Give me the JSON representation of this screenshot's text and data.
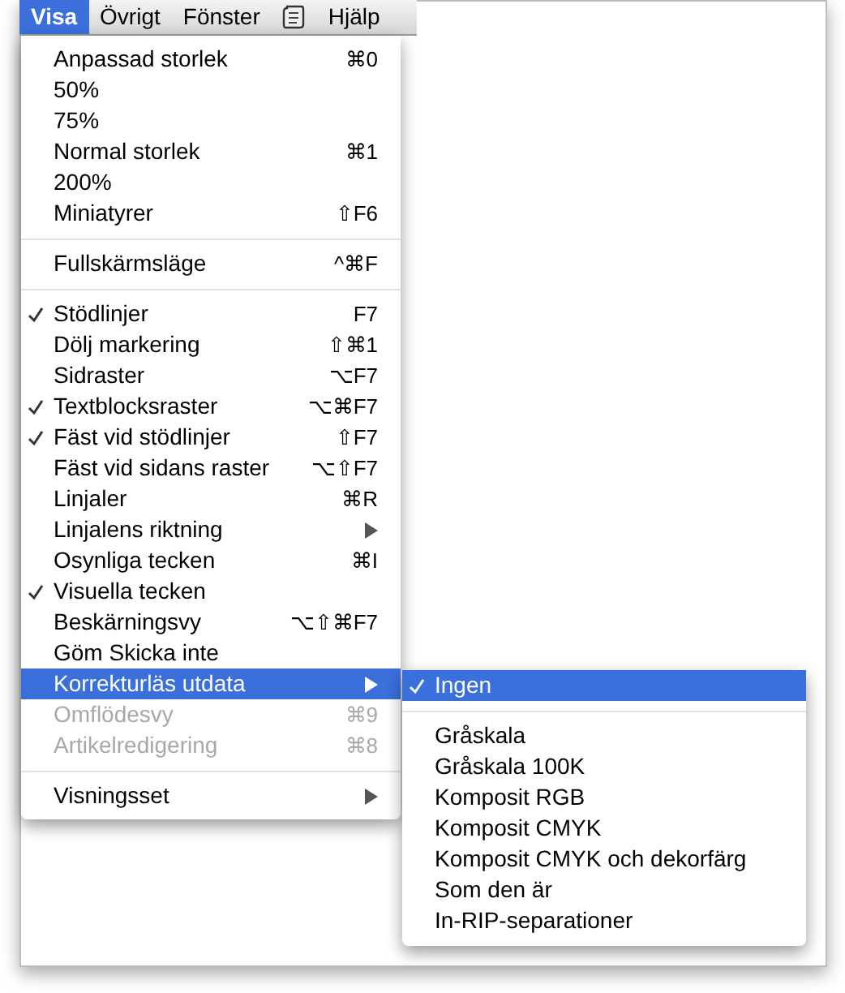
{
  "menubar": [
    {
      "kind": "text",
      "label": "Visa",
      "selected": true
    },
    {
      "kind": "text",
      "label": "Övrigt",
      "selected": false
    },
    {
      "kind": "text",
      "label": "Fönster",
      "selected": false
    },
    {
      "kind": "icon",
      "selected": false
    },
    {
      "kind": "text",
      "label": "Hjälp",
      "selected": false
    }
  ],
  "menu": [
    {
      "kind": "item",
      "label": "Anpassad storlek",
      "shortcut": "⌘0",
      "checked": false,
      "disabled": false,
      "selected": false
    },
    {
      "kind": "item",
      "label": "50%",
      "checked": false,
      "disabled": false,
      "selected": false
    },
    {
      "kind": "item",
      "label": "75%",
      "checked": false,
      "disabled": false,
      "selected": false
    },
    {
      "kind": "item",
      "label": "Normal storlek",
      "shortcut": "⌘1",
      "checked": false,
      "disabled": false,
      "selected": false
    },
    {
      "kind": "item",
      "label": "200%",
      "checked": false,
      "disabled": false,
      "selected": false
    },
    {
      "kind": "item",
      "label": "Miniatyrer",
      "shortcut": "⇧F6",
      "checked": false,
      "disabled": false,
      "selected": false
    },
    {
      "kind": "separator"
    },
    {
      "kind": "item",
      "label": "Fullskärmsläge",
      "shortcut": "^⌘F",
      "checked": false,
      "disabled": false,
      "selected": false
    },
    {
      "kind": "separator"
    },
    {
      "kind": "item",
      "label": "Stödlinjer",
      "shortcut": "F7",
      "checked": true,
      "disabled": false,
      "selected": false
    },
    {
      "kind": "item",
      "label": "Dölj markering",
      "shortcut": "⇧⌘1",
      "checked": false,
      "disabled": false,
      "selected": false
    },
    {
      "kind": "item",
      "label": "Sidraster",
      "shortcut": "⌥F7",
      "checked": false,
      "disabled": false,
      "selected": false
    },
    {
      "kind": "item",
      "label": "Textblocksraster",
      "shortcut": "⌥⌘F7",
      "checked": true,
      "disabled": false,
      "selected": false
    },
    {
      "kind": "item",
      "label": "Fäst vid stödlinjer",
      "shortcut": "⇧F7",
      "checked": true,
      "disabled": false,
      "selected": false
    },
    {
      "kind": "item",
      "label": "Fäst vid sidans raster",
      "shortcut": "⌥⇧F7",
      "checked": false,
      "disabled": false,
      "selected": false
    },
    {
      "kind": "item",
      "label": "Linjaler",
      "shortcut": "⌘R",
      "checked": false,
      "disabled": false,
      "selected": false
    },
    {
      "kind": "submenu",
      "label": "Linjalens riktning",
      "checked": false,
      "disabled": false,
      "selected": false
    },
    {
      "kind": "item",
      "label": "Osynliga tecken",
      "shortcut": "⌘I",
      "checked": false,
      "disabled": false,
      "selected": false
    },
    {
      "kind": "item",
      "label": "Visuella tecken",
      "checked": true,
      "disabled": false,
      "selected": false
    },
    {
      "kind": "item",
      "label": "Beskärningsvy",
      "shortcut": "⌥⇧⌘F7",
      "checked": false,
      "disabled": false,
      "selected": false
    },
    {
      "kind": "item",
      "label": "Göm Skicka inte",
      "checked": false,
      "disabled": false,
      "selected": false
    },
    {
      "kind": "submenu",
      "label": "Korrekturläs utdata",
      "checked": false,
      "disabled": false,
      "selected": true
    },
    {
      "kind": "item",
      "label": "Omflödesvy",
      "shortcut": "⌘9",
      "checked": false,
      "disabled": true,
      "selected": false
    },
    {
      "kind": "item",
      "label": "Artikelredigering",
      "shortcut": "⌘8",
      "checked": false,
      "disabled": true,
      "selected": false
    },
    {
      "kind": "separator"
    },
    {
      "kind": "submenu",
      "label": "Visningsset",
      "checked": false,
      "disabled": false,
      "selected": false
    }
  ],
  "submenu": [
    {
      "kind": "item",
      "label": "Ingen",
      "checked": true,
      "selected": true
    },
    {
      "kind": "separator"
    },
    {
      "kind": "item",
      "label": "Gråskala",
      "checked": false,
      "selected": false
    },
    {
      "kind": "item",
      "label": "Gråskala 100K",
      "checked": false,
      "selected": false
    },
    {
      "kind": "item",
      "label": "Komposit RGB",
      "checked": false,
      "selected": false
    },
    {
      "kind": "item",
      "label": "Komposit CMYK",
      "checked": false,
      "selected": false
    },
    {
      "kind": "item",
      "label": "Komposit CMYK och dekorfärg",
      "checked": false,
      "selected": false
    },
    {
      "kind": "item",
      "label": "Som den är",
      "checked": false,
      "selected": false
    },
    {
      "kind": "item",
      "label": "In-RIP-separationer",
      "checked": false,
      "selected": false
    }
  ]
}
